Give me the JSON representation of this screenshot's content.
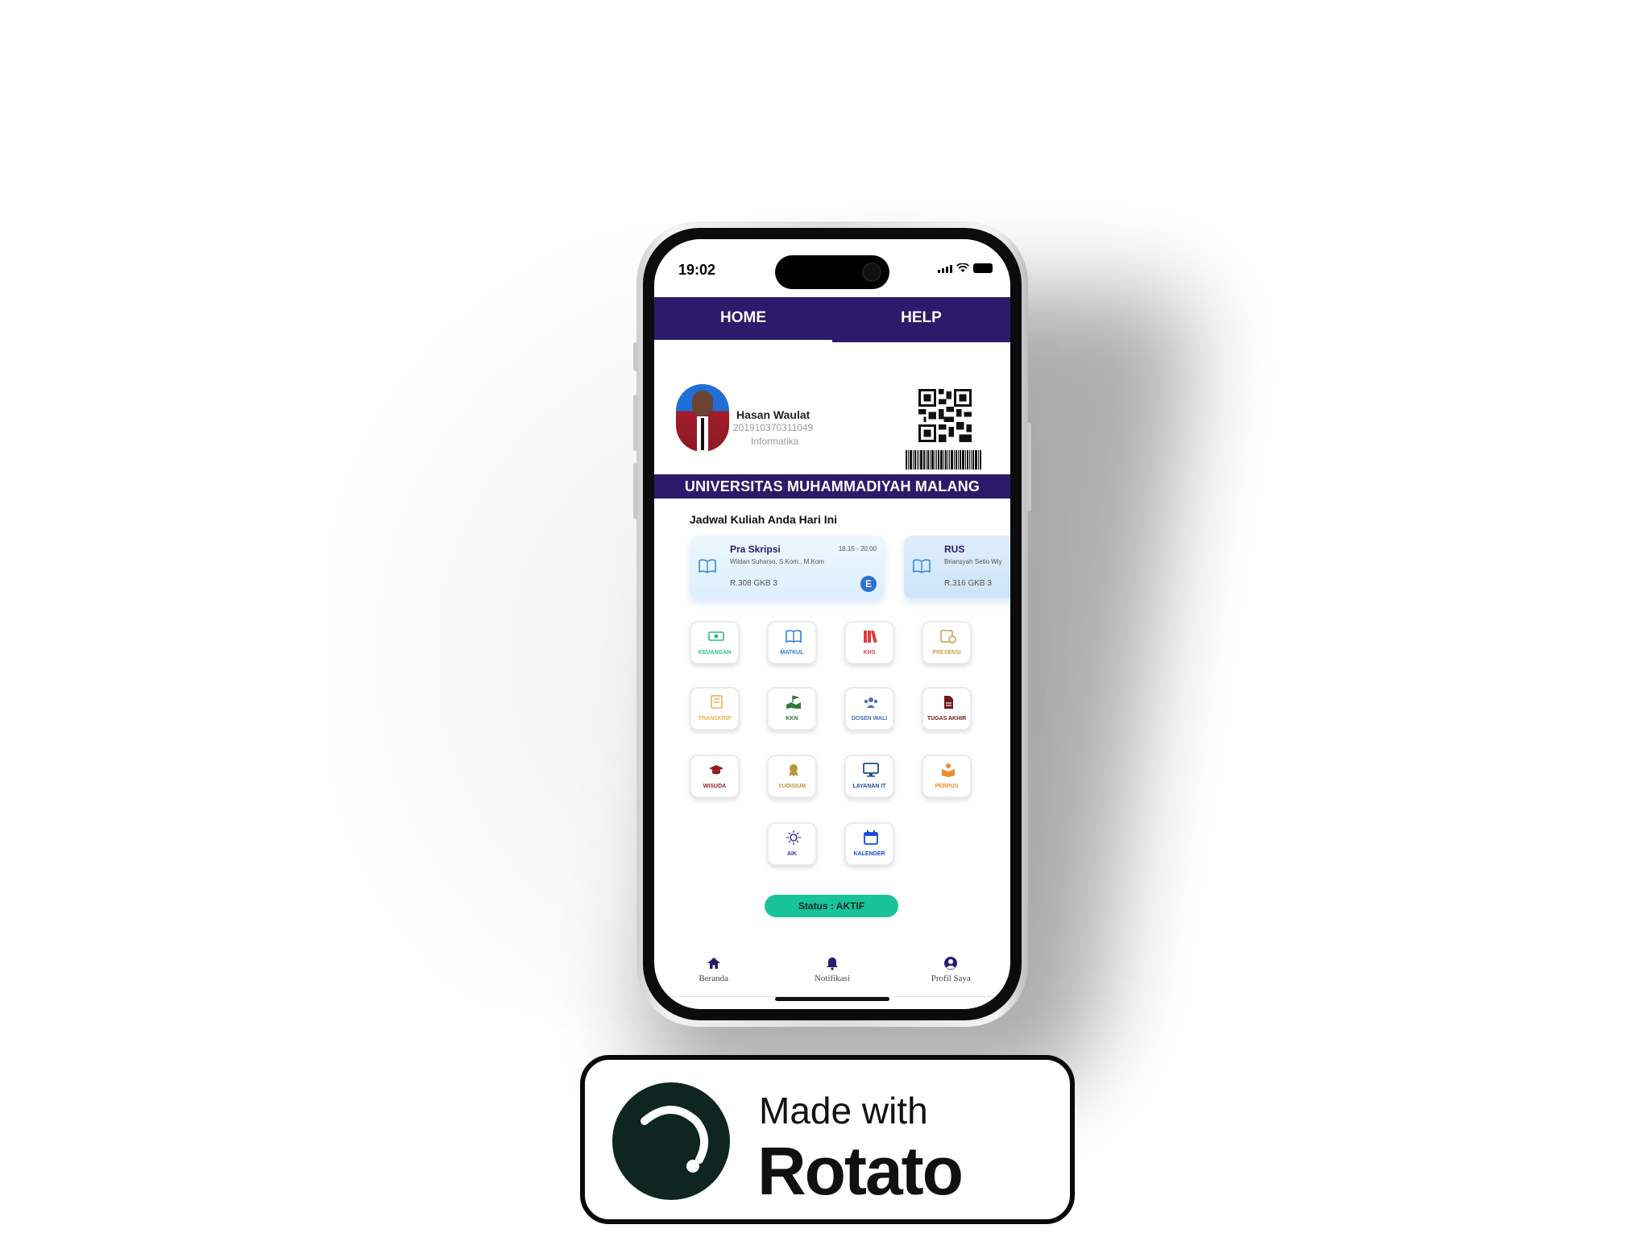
{
  "status_bar": {
    "time": "19:02"
  },
  "top_nav": {
    "tabs": [
      {
        "label": "HOME",
        "active": true
      },
      {
        "label": "HELP",
        "active": false
      }
    ]
  },
  "profile": {
    "name": "Hasan Waulat",
    "nim": "201910370311049",
    "program": "Informatika"
  },
  "university_banner": "UNIVERSITAS MUHAMMADIYAH MALANG",
  "schedule": {
    "title": "Jadwal Kuliah Anda Hari Ini",
    "cards": [
      {
        "course": "Pra Skripsi",
        "time": "18.15 - 20.00",
        "lecturer": "Wildan Suharso, S.Kom., M.Kom",
        "room": "R.308 GKB 3",
        "badge": "E"
      },
      {
        "course": "RUS",
        "lecturer": "Briansyah Setio Wiy",
        "room": "R.316 GKB 3"
      }
    ]
  },
  "menu": [
    {
      "label": "KEUANGAN",
      "icon": "cash-icon",
      "color": "#2bbf7a"
    },
    {
      "label": "MATKUL",
      "icon": "book-icon",
      "color": "#2d7fd6"
    },
    {
      "label": "KHS",
      "icon": "books-icon",
      "color": "#e23b3b"
    },
    {
      "label": "PRESENSI",
      "icon": "calendar-clock-icon",
      "color": "#c9a24a"
    },
    {
      "label": "TRANSKRIP",
      "icon": "document-stack-icon",
      "color": "#e8b44b"
    },
    {
      "label": "KKN",
      "icon": "map-flag-icon",
      "color": "#2f7a3b"
    },
    {
      "label": "DOSEN WALI",
      "icon": "people-icon",
      "color": "#4a6fb0"
    },
    {
      "label": "TUGAS AKHIR",
      "icon": "file-icon",
      "color": "#6e1a1a"
    },
    {
      "label": "WISUDA",
      "icon": "graduation-cap-icon",
      "color": "#8e1f1f"
    },
    {
      "label": "YUDISIUM",
      "icon": "award-icon",
      "color": "#b8963a"
    },
    {
      "label": "LAYANAN IT",
      "icon": "monitor-icon",
      "color": "#1f4f8a"
    },
    {
      "label": "PERPUS",
      "icon": "reader-icon",
      "color": "#f08a30"
    },
    {
      "label": "AIK",
      "icon": "sun-emblem-icon",
      "color": "#3a3aa0"
    },
    {
      "label": "KALENDER",
      "icon": "calendar-icon",
      "color": "#1a4bd6"
    }
  ],
  "status_pill": "Status : AKTIF",
  "bottom_nav": [
    {
      "label": "Beranda",
      "icon": "home-icon"
    },
    {
      "label": "Notifikasi",
      "icon": "bell-icon"
    },
    {
      "label": "Profil Saya",
      "icon": "user-circle-icon"
    }
  ],
  "badge": {
    "line1": "Made with",
    "line2": "Rotato"
  },
  "colors": {
    "primary": "#2c1a6b",
    "status": "#19c39a",
    "card_bg": "#e6f3ff"
  }
}
